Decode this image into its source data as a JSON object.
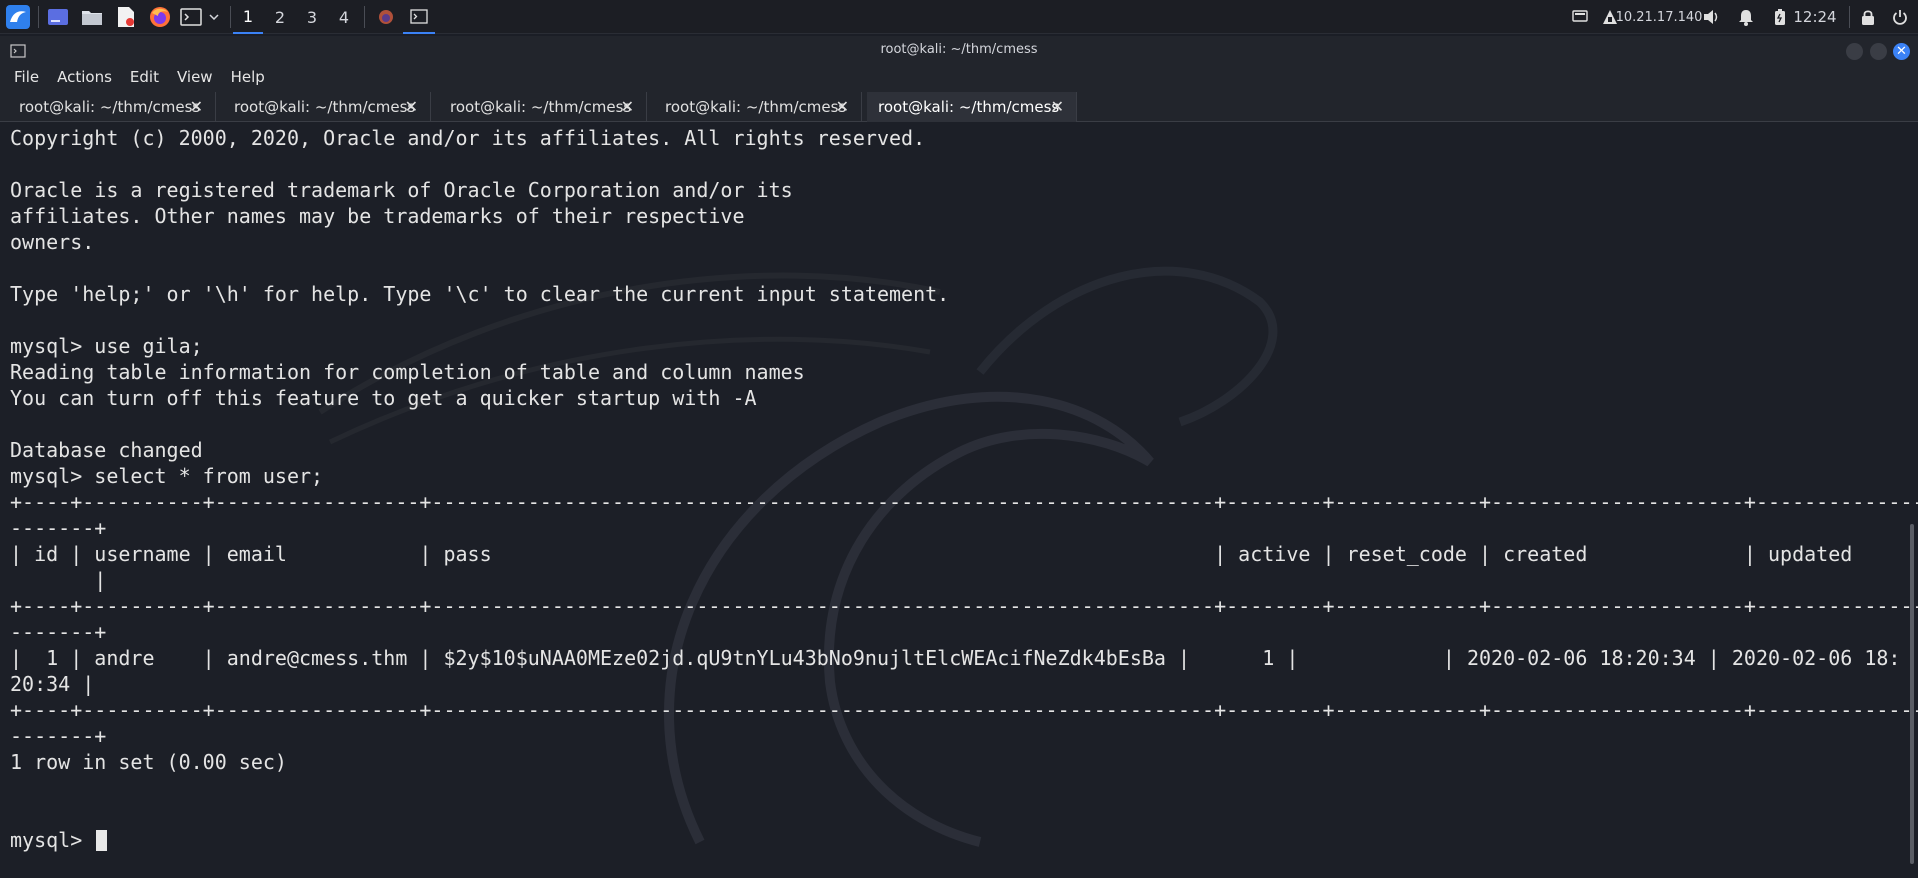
{
  "panel": {
    "workspaces": [
      "1",
      "2",
      "3",
      "4"
    ],
    "ip": "10.21.17.140",
    "clock": "12:24",
    "icons": [
      "kali-menu-icon",
      "show-desktop-icon",
      "file-manager-icon",
      "text-editor-icon",
      "firefox-icon",
      "terminal-icon",
      "dropdown-icon",
      "firefox-window-icon",
      "terminal-window-icon",
      "display-icon",
      "network-icon",
      "volume-icon",
      "notifications-icon",
      "battery-icon",
      "lock-icon",
      "power-icon"
    ]
  },
  "window": {
    "title": "root@kali: ~/thm/cmess",
    "menu": [
      "File",
      "Actions",
      "Edit",
      "View",
      "Help"
    ],
    "tabs": [
      {
        "label": "root@kali: ~/thm/cmess"
      },
      {
        "label": "root@kali: ~/thm/cmess"
      },
      {
        "label": "root@kali: ~/thm/cmess"
      },
      {
        "label": "root@kali: ~/thm/cmess"
      },
      {
        "label": "root@kali: ~/thm/cmess"
      }
    ]
  },
  "terminal": {
    "lines": [
      "Copyright (c) 2000, 2020, Oracle and/or its affiliates. All rights reserved.",
      "",
      "Oracle is a registered trademark of Oracle Corporation and/or its",
      "affiliates. Other names may be trademarks of their respective",
      "owners.",
      "",
      "Type 'help;' or '\\h' for help. Type '\\c' to clear the current input statement.",
      "",
      "mysql> use gila;",
      "Reading table information for completion of table and column names",
      "You can turn off this feature to get a quicker startup with -A",
      "",
      "Database changed",
      "mysql> select * from user;",
      "+----+----------+-----------------+-----------------------------------------------------------------+--------+------------+---------------------+--------------------",
      "-------+",
      "| id | username | email           | pass                                                            | active | reset_code | created             | updated            ",
      "       |",
      "+----+----------+-----------------+-----------------------------------------------------------------+--------+------------+---------------------+--------------------",
      "-------+",
      "|  1 | andre    | andre@cmess.thm | $2y$10$uNAA0MEze02jd.qU9tnYLu43bNo9nujltElcWEAcifNeZdk4bEsBa |      1 |            | 2020-02-06 18:20:34 | 2020-02-06 18:",
      "20:34 |",
      "+----+----------+-----------------+-----------------------------------------------------------------+--------+------------+---------------------+--------------------",
      "-------+",
      "1 row in set (0.00 sec)",
      "",
      "mysql> "
    ]
  }
}
